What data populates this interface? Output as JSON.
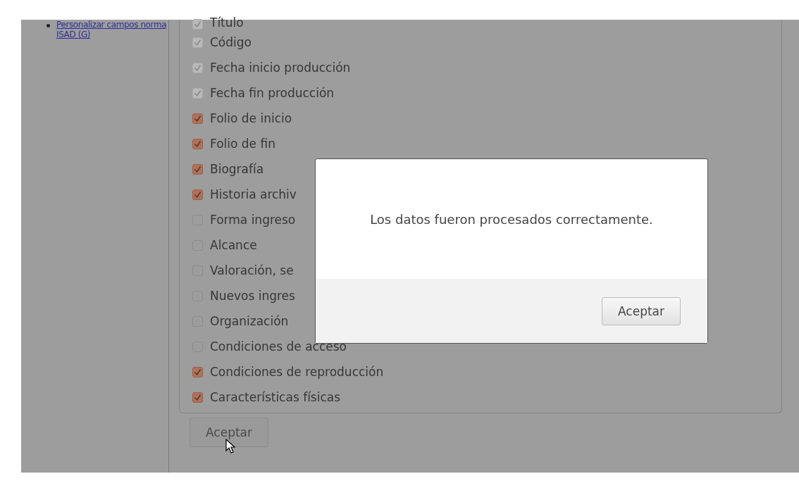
{
  "sidebar": {
    "links": [
      "Personalizar campos norma ISAD (G)"
    ]
  },
  "fields": [
    {
      "label": "Título",
      "checked": true,
      "disabled": true
    },
    {
      "label": "Código",
      "checked": true,
      "disabled": true
    },
    {
      "label": "Fecha inicio producción",
      "checked": true,
      "disabled": true
    },
    {
      "label": "Fecha fin producción",
      "checked": true,
      "disabled": true
    },
    {
      "label": "Folio de inicio",
      "checked": true,
      "disabled": false
    },
    {
      "label": "Folio de fin",
      "checked": true,
      "disabled": false
    },
    {
      "label": "Biografía",
      "checked": true,
      "disabled": false
    },
    {
      "label": "Historia archiv",
      "checked": true,
      "disabled": false
    },
    {
      "label": "Forma ingreso",
      "checked": false,
      "disabled": false
    },
    {
      "label": "Alcance",
      "checked": false,
      "disabled": false
    },
    {
      "label": "Valoración, se",
      "checked": false,
      "disabled": false
    },
    {
      "label": "Nuevos ingres",
      "checked": false,
      "disabled": false
    },
    {
      "label": "Organización",
      "checked": false,
      "disabled": false
    },
    {
      "label": "Condiciones de acceso",
      "checked": false,
      "disabled": false
    },
    {
      "label": "Condiciones de reproducción",
      "checked": true,
      "disabled": false
    },
    {
      "label": "Características físicas",
      "checked": true,
      "disabled": false
    }
  ],
  "submit_button": {
    "label": "Aceptar"
  },
  "dialog": {
    "message": "Los datos fueron procesados correctamente.",
    "button": "Aceptar"
  }
}
